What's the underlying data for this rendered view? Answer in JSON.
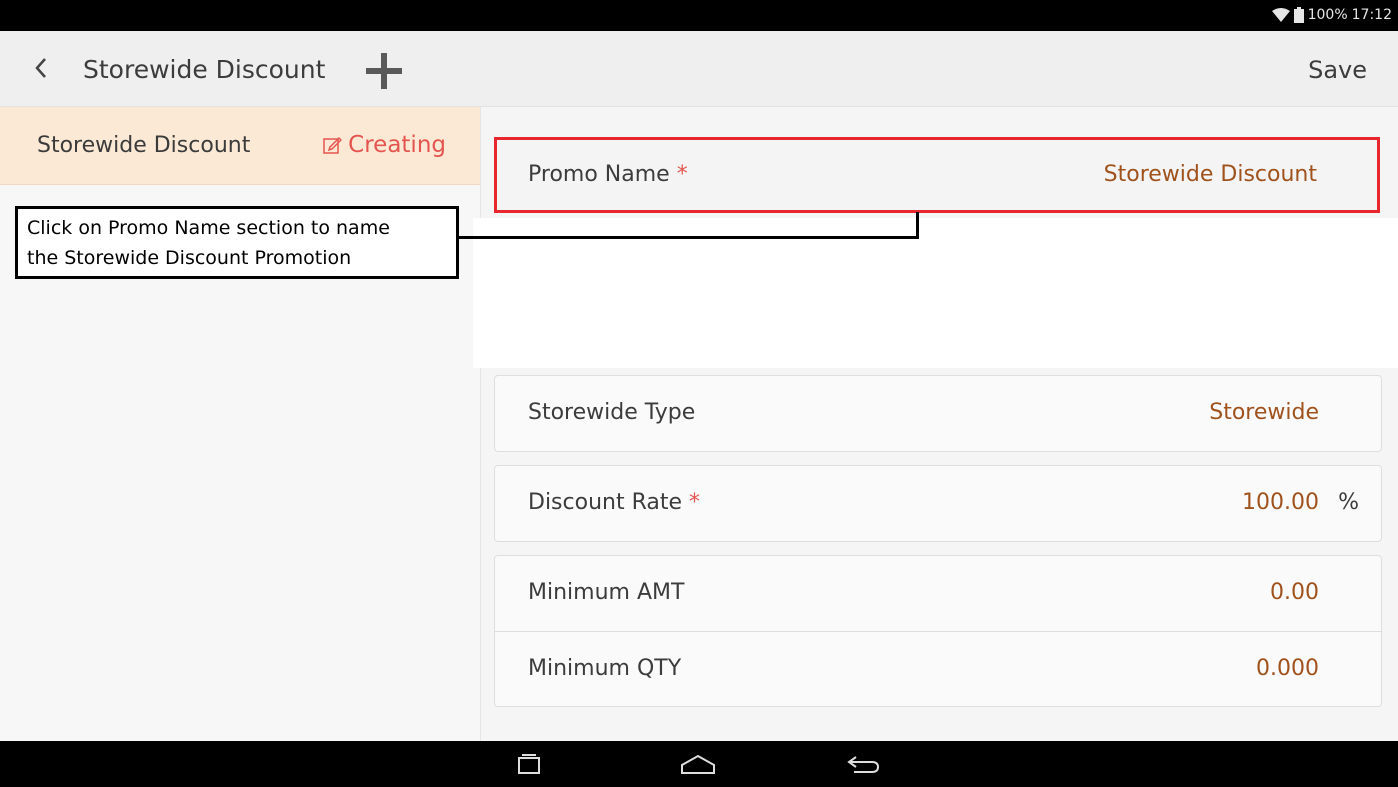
{
  "status_bar": {
    "battery": "100%",
    "time": "17:12"
  },
  "toolbar": {
    "title": "Storewide Discount",
    "save_label": "Save"
  },
  "left_list": {
    "items": [
      {
        "title": "Storewide Discount",
        "status": "Creating"
      }
    ]
  },
  "annotation": {
    "line1": "Click on Promo Name section to name",
    "line2": "the Storewide Discount Promotion"
  },
  "form": {
    "promo_name": {
      "label": "Promo Name",
      "required_mark": "*",
      "value": "Storewide Discount"
    },
    "storewide_type": {
      "label": "Storewide Type",
      "value": "Storewide"
    },
    "discount_rate": {
      "label": "Discount Rate",
      "required_mark": "*",
      "value": "100.00",
      "unit": "%"
    },
    "minimum_amt": {
      "label": "Minimum AMT",
      "value": "0.00"
    },
    "minimum_qty": {
      "label": "Minimum QTY",
      "value": "0.000"
    }
  },
  "colors": {
    "accent_value": "#a0521d",
    "required_red": "#e5554f",
    "highlight_border": "#e8262e",
    "selected_item_bg": "#fbe9d6"
  },
  "icons": {
    "status": [
      "wifi-icon",
      "battery-icon"
    ],
    "toolbar": [
      "back-chevron-icon",
      "plus-icon"
    ],
    "left_item": "edit-icon",
    "nav": [
      "recent-apps-icon",
      "home-icon",
      "back-icon"
    ]
  }
}
